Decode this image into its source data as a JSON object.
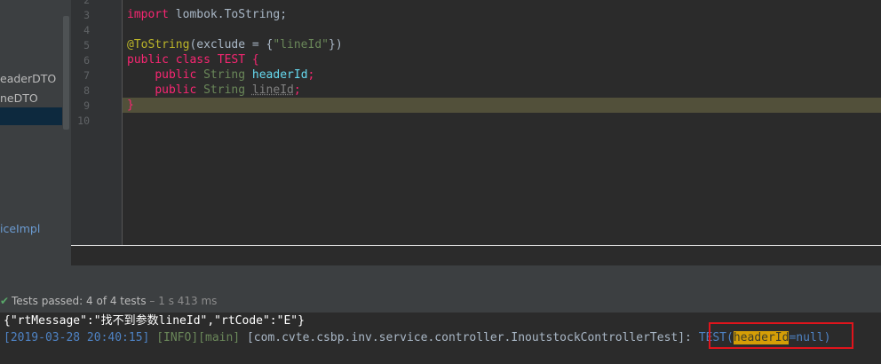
{
  "sidebar": {
    "items": [
      {
        "label": "eaderDTO"
      },
      {
        "label": "neDTO"
      },
      {
        "label": "iceImpl"
      }
    ]
  },
  "gutter": {
    "lines": [
      "2",
      "3",
      "4",
      "5",
      "6",
      "7",
      "8",
      "9",
      "10"
    ]
  },
  "editor": {
    "line3": {
      "kw": "import",
      "rest": " lombok.ToString;"
    },
    "line5": {
      "ann": "@ToString",
      "open": "(exclude = {",
      "str": "\"lineId\"",
      "close": "})"
    },
    "line6": {
      "kw1": "public",
      "kw2": "class",
      "name": " TEST {"
    },
    "line7": {
      "kw": "public",
      "type": "String",
      "field": "headerId",
      "semi": ";"
    },
    "line8": {
      "kw": "public",
      "type": "String",
      "field": "lineId",
      "semi": ";"
    },
    "line9": {
      "brace": "}"
    }
  },
  "status": {
    "prefix": "Tests passed: ",
    "count": "4 of 4 tests",
    "time": " – 1 s 413 ms"
  },
  "console": {
    "json_line": "{\"rtMessage\":\"找不到参数lineId\",\"rtCode\":\"E\"}",
    "timestamp": "[2019-03-28 20:40:15]",
    "level": "[INFO]",
    "thread": "[main]",
    "class": "[com.cvte.csbp.inv.service.controller.InoutstockControllerTest]:",
    "test_open": "TEST(",
    "highlight": "headerId",
    "test_close": "=null)"
  },
  "colors": {
    "highlight_border": "#e0141c",
    "passed": "#59a869"
  }
}
